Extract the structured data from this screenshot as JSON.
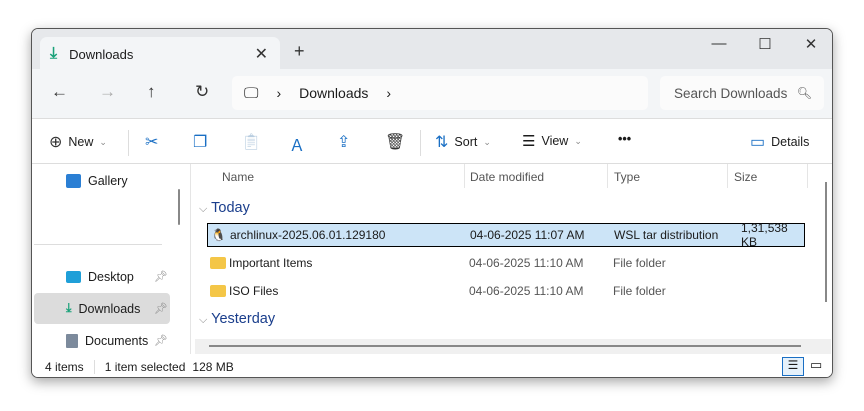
{
  "tab": {
    "title": "Downloads",
    "close": "✕",
    "new_tab": "+"
  },
  "window_controls": {
    "minimize": "—",
    "maximize": "☐",
    "close": "✕"
  },
  "nav": {
    "back": "←",
    "forward": "→",
    "up": "↑",
    "refresh": "↻"
  },
  "address": {
    "separator": "›",
    "crumb": "Downloads",
    "chevron": "›"
  },
  "search": {
    "placeholder": "Search Downloads"
  },
  "toolbar": {
    "new": "New",
    "sort": "Sort",
    "view": "View",
    "more": "•••",
    "details": "Details"
  },
  "sidebar": {
    "items": [
      {
        "label": "Gallery"
      },
      {
        "label": "Desktop"
      },
      {
        "label": "Downloads"
      },
      {
        "label": "Documents"
      }
    ]
  },
  "columns": [
    "Name",
    "Date modified",
    "Type",
    "Size"
  ],
  "groups": [
    "Today",
    "Yesterday"
  ],
  "files": [
    {
      "name": "archlinux-2025.06.01.129180",
      "date": "04-06-2025 11:07 AM",
      "type": "WSL tar distribution",
      "size": "1,31,538 KB"
    },
    {
      "name": "Important Items",
      "date": "04-06-2025 11:10 AM",
      "type": "File folder",
      "size": ""
    },
    {
      "name": "ISO Files",
      "date": "04-06-2025 11:10 AM",
      "type": "File folder",
      "size": ""
    }
  ],
  "status": {
    "count": "4 items",
    "selected": "1 item selected",
    "size": "128 MB"
  }
}
